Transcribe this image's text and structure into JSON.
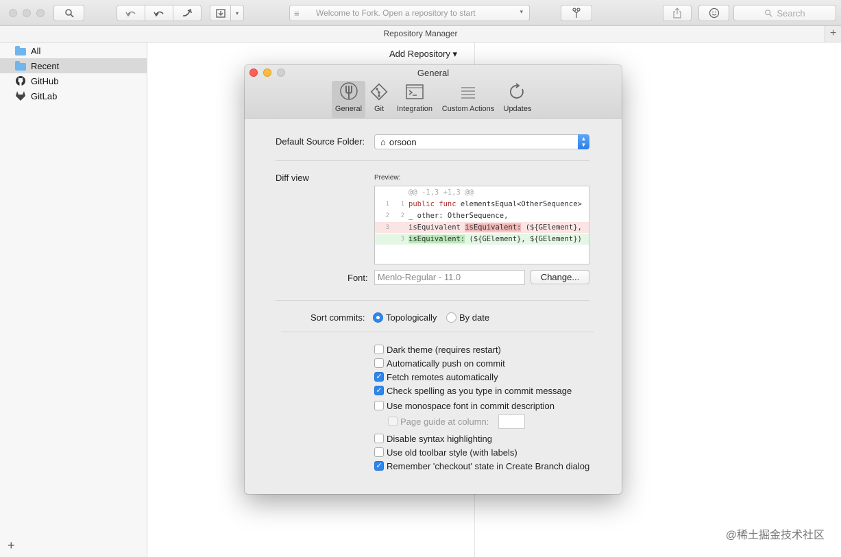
{
  "toolbar": {
    "repo_placeholder": "Welcome to Fork. Open a repository to start",
    "search_placeholder": "Search"
  },
  "repo_manager": {
    "title": "Repository Manager",
    "add_repository": "Add Repository ▾"
  },
  "sidebar": {
    "items": [
      {
        "label": "All",
        "icon": "folder-icon",
        "selected": false
      },
      {
        "label": "Recent",
        "icon": "folder-icon",
        "selected": true
      },
      {
        "label": "GitHub",
        "icon": "github-icon",
        "selected": false
      },
      {
        "label": "GitLab",
        "icon": "gitlab-icon",
        "selected": false
      }
    ]
  },
  "dialog": {
    "title": "General",
    "tabs": [
      {
        "label": "General",
        "icon": "tuning-fork-icon",
        "active": true
      },
      {
        "label": "Git",
        "icon": "git-icon",
        "active": false
      },
      {
        "label": "Integration",
        "icon": "terminal-icon",
        "active": false
      },
      {
        "label": "Custom Actions",
        "icon": "list-icon",
        "active": false
      },
      {
        "label": "Updates",
        "icon": "refresh-icon",
        "active": false
      }
    ],
    "default_source_folder_label": "Default Source Folder:",
    "default_source_folder_value": "orsoon",
    "diff_view_label": "Diff view",
    "preview_label": "Preview:",
    "preview": {
      "hunk": "@@ -1,3 +1,3 @@",
      "lines": [
        {
          "old": "1",
          "new": "1",
          "code_kw": "public func ",
          "code_rest": "elementsEqual<OtherSequence>"
        },
        {
          "old": "2",
          "new": "2",
          "code_kw": "",
          "code_rest": "_ other: OtherSequence,"
        },
        {
          "old": "3",
          "new": "",
          "part1": "isEquivalent ",
          "part2": "isEquivalent:",
          "part3": " (${GElement}, "
        },
        {
          "old": "",
          "new": "3",
          "part1": "isEquivalent:",
          "part3": " (${GElement}, ${GElement})"
        }
      ]
    },
    "font_label": "Font:",
    "font_value": "Menlo-Regular - 11.0",
    "change_button": "Change...",
    "sort_commits_label": "Sort commits:",
    "sort_options": [
      {
        "label": "Topologically",
        "selected": true
      },
      {
        "label": "By date",
        "selected": false
      }
    ],
    "checkboxes": [
      {
        "label": "Dark theme (requires restart)",
        "checked": false
      },
      {
        "label": "Automatically push on commit",
        "checked": false
      },
      {
        "label": "Fetch remotes automatically",
        "checked": true
      },
      {
        "label": "Check spelling as you type in commit message",
        "checked": true
      },
      {
        "label": "Use monospace font in commit description",
        "checked": false
      },
      {
        "label": "Page guide at column:",
        "checked": false,
        "disabled": true
      },
      {
        "label": "Disable syntax highlighting",
        "checked": false
      },
      {
        "label": "Use old toolbar style (with labels)",
        "checked": false
      },
      {
        "label": "Remember 'checkout' state in Create Branch dialog",
        "checked": true
      }
    ]
  },
  "watermark": "@稀土掘金技术社区"
}
